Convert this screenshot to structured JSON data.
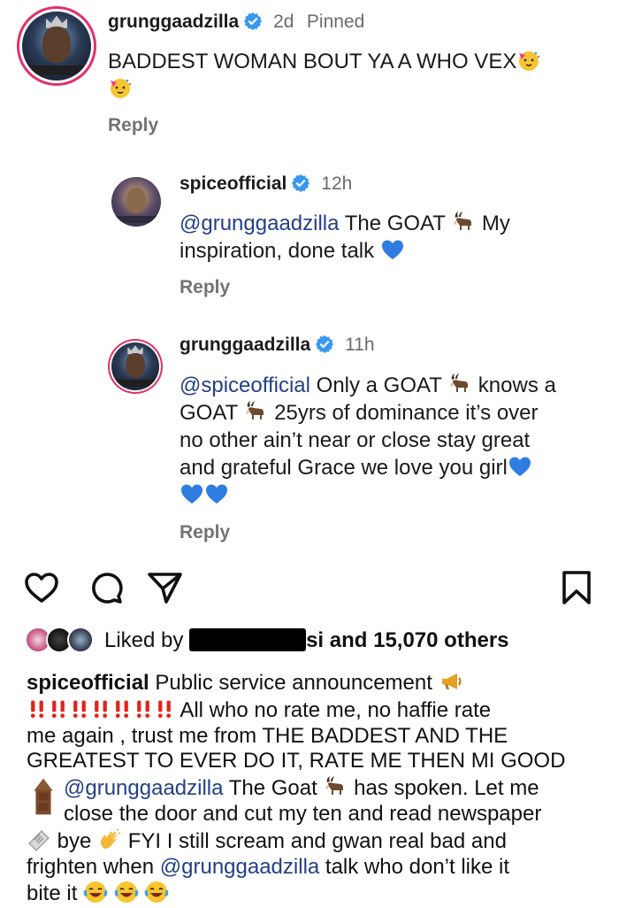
{
  "comments": [
    {
      "username": "grunggaadzilla",
      "time": "2d",
      "badge": "Pinned",
      "text": "BADDEST WOMAN BOUT YA A WHO VEX",
      "reply_label": "Reply"
    }
  ],
  "replies": [
    {
      "username": "spiceofficial",
      "time": "12h",
      "mention": "@grunggaadzilla",
      "text_line1": " The GOAT ",
      "text_line1b": " My",
      "text_line2": "inspiration, done talk ",
      "reply_label": "Reply"
    },
    {
      "username": "grunggaadzilla",
      "time": "11h",
      "mention": "@spiceofficial",
      "text_line1": " Only a GOAT ",
      "text_line1b": " knows a",
      "text_line2a": "GOAT ",
      "text_line2b": " 25yrs of dominance it’s over",
      "text_line3": "no other ain’t near or close stay great",
      "text_line4": "and grateful Grace we love you girl",
      "reply_label": "Reply"
    }
  ],
  "post": {
    "liked_by_prefix": "Liked by ",
    "liked_by_suffix": "si and ",
    "liked_count": "15,070 others",
    "caption": {
      "username": "spiceofficial",
      "l1": " Public service announcement ",
      "l2": " All who no rate me, no haffie rate",
      "l3": "me again , trust me from THE BADDEST AND THE",
      "l4": "GREATEST TO EVER DO IT, RATE ME THEN MI GOOD",
      "l5_mention": "@grunggaadzilla",
      "l5_text": " The Goat ",
      "l5_tail": " has spoken. Let me",
      "l6": "close the door and cut my ten and read newspaper",
      "l7a": " bye ",
      "l7b": " FYI I still scream and gwan real bad and",
      "l8a": "frighten when ",
      "l8_mention": "@grunggaadzilla",
      "l8b": " talk who don’t like it",
      "l9": "bite it "
    }
  },
  "icons": {
    "verified": "verified-badge-icon",
    "heart": "heart-icon",
    "comment": "comment-icon",
    "share": "send-icon",
    "save": "bookmark-icon",
    "goat": "goat-icon",
    "blue_heart": "blue-heart-icon",
    "party": "party-face-icon",
    "megaphone": "megaphone-icon",
    "double_exclamation": "double-exclamation-icon",
    "door": "door-icon",
    "newspaper": "newspaper-icon",
    "wave": "waving-hand-icon",
    "laugh": "tears-of-joy-icon"
  },
  "colors": {
    "verified": "#3897f0",
    "mention": "#233f86",
    "meta": "#6b6b6b",
    "accent_red": "#e0241b"
  }
}
